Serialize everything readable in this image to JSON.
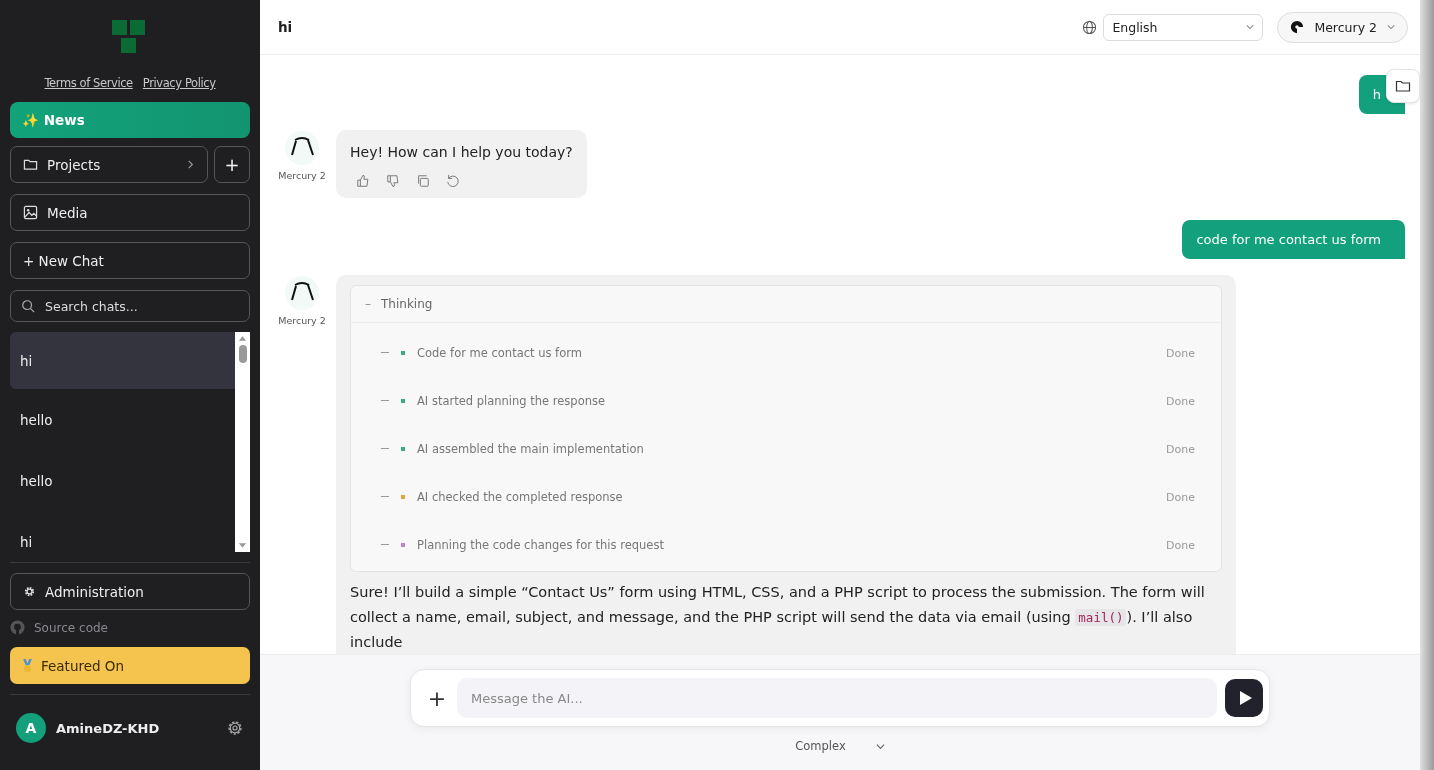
{
  "sidebar": {
    "links": [
      "Terms of Service",
      "Privacy Policy"
    ],
    "news": {
      "icon": "✨",
      "label": "News"
    },
    "projects": {
      "label": "Projects",
      "add": "+"
    },
    "media": {
      "label": "Media"
    },
    "new_chat": {
      "label": "+ New Chat"
    },
    "search": {
      "placeholder": "Search chats..."
    },
    "chats": [
      {
        "title": "hi",
        "selected": true
      },
      {
        "title": "hello",
        "selected": false
      },
      {
        "title": "hello",
        "selected": false
      },
      {
        "title": "hi",
        "selected": false
      }
    ],
    "administration": {
      "label": "Administration"
    },
    "source_code": {
      "label": "Source code"
    },
    "featured": {
      "label": "Featured On"
    },
    "user": {
      "initial": "A",
      "name": "AmineDZ-KHD"
    }
  },
  "header": {
    "title": "hi",
    "language": "English",
    "model": "Mercury 2"
  },
  "messages": [
    {
      "kind": "user",
      "text": "h"
    },
    {
      "kind": "assistant",
      "author": "Mercury 2",
      "text": "Hey! How can I help you today?"
    },
    {
      "kind": "user",
      "text": "code for me contact us form"
    },
    {
      "kind": "assistant",
      "author": "Mercury 2",
      "thinking": {
        "toggle": "–",
        "title": "Thinking",
        "expanded": true,
        "steps": [
          {
            "label": "Code for me contact us form",
            "status": "Done",
            "color": "#3aa88a"
          },
          {
            "label": "AI started planning the response",
            "status": "Done",
            "color": "#3aa88a"
          },
          {
            "label": "AI assembled the main implementation",
            "status": "Done",
            "color": "#3aa88a"
          },
          {
            "label": "AI checked the completed response",
            "status": "Done",
            "color": "#e8a23a"
          },
          {
            "label": "Planning the code changes for this request",
            "status": "Done",
            "color": "#c77dd6"
          }
        ]
      },
      "text_before": "Sure! I’ll build a simple “Contact Us” form using HTML, CSS, and a PHP script to process the submission. The form will collect a name, email, subject, and message, and the PHP script will send the data via email (using",
      "code": "mail()",
      "text_after": "). I’ll also include"
    }
  ],
  "composer": {
    "add": "+",
    "placeholder": "Message the AI...",
    "mode": "Complex"
  }
}
